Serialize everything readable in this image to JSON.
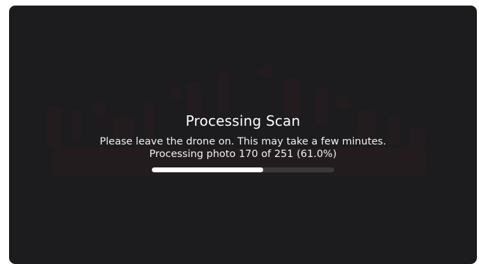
{
  "dialog": {
    "title": "Processing Scan",
    "message": "Please leave the drone on. This may take a few minutes.",
    "status": "Processing photo 170 of 251 (61.0%)"
  },
  "progress": {
    "current": 170,
    "total": 251,
    "fraction": 0.61
  },
  "colors": {
    "background": "#1c1c1e",
    "text": "#ffffff",
    "track": "#3a3a3c",
    "fill": "#ffffff"
  }
}
